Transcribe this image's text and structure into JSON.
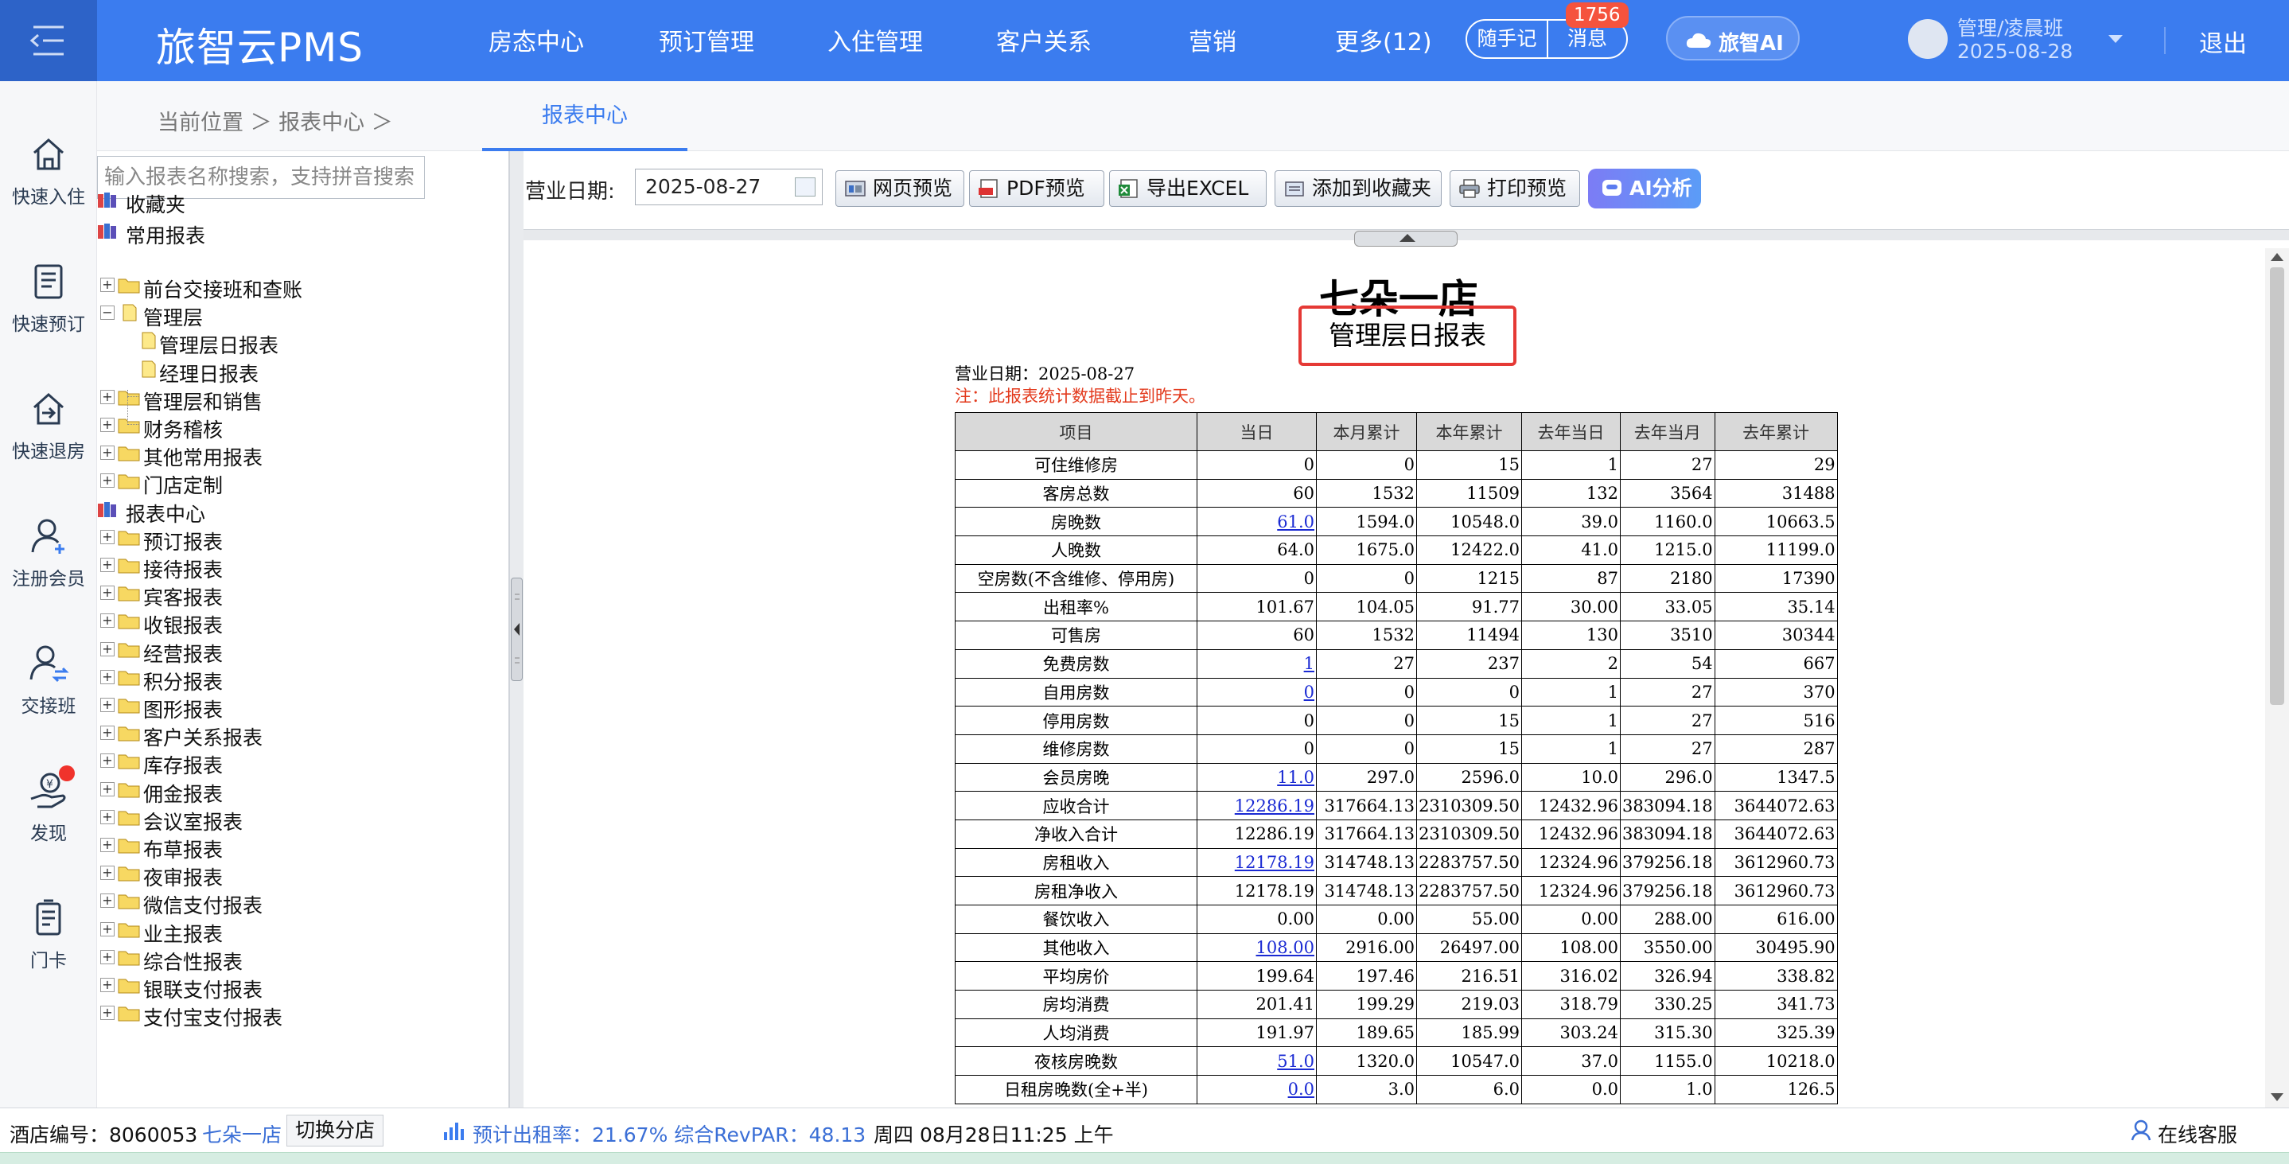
{
  "app": {
    "logo": "旅智云PMS",
    "nav": [
      "房态中心",
      "预订管理",
      "入住管理",
      "客户关系",
      "营销",
      "更多(12)"
    ],
    "memo_label": "随手记",
    "message_label": "消息",
    "message_badge": "1756",
    "ai_label": "旅智AI",
    "user_name": "管理/凌晨班",
    "user_date": "2025-08-28",
    "logout_label": "退出",
    "colors": {
      "primary": "#3b7cef",
      "highlight_border": "#e53935",
      "note": "#e33a1d",
      "link": "#1a2ad3"
    }
  },
  "sidebar": [
    {
      "label": "快速入住",
      "icon": "home-icon"
    },
    {
      "label": "快速预订",
      "icon": "booking-icon"
    },
    {
      "label": "快速退房",
      "icon": "checkout-icon"
    },
    {
      "label": "注册会员",
      "icon": "add-user-icon"
    },
    {
      "label": "交接班",
      "icon": "handover-icon"
    },
    {
      "label": "发现",
      "icon": "discover-icon"
    },
    {
      "label": "门卡",
      "icon": "card-icon"
    }
  ],
  "breadcrumb": "当前位置 ＞ 报表中心 ＞",
  "active_tab": "报表中心",
  "tree": {
    "search_placeholder": "输入报表名称搜索，支持拼音搜索",
    "favorites": "收藏夹",
    "common": "常用报表",
    "common_items": [
      "前台交接班和查账",
      "管理层",
      "管理层和销售",
      "财务稽核",
      "其他常用报表",
      "门店定制"
    ],
    "management_children": [
      "管理层日报表",
      "经理日报表"
    ],
    "center": "报表中心",
    "center_items": [
      "预订报表",
      "接待报表",
      "宾客报表",
      "收银报表",
      "经营报表",
      "积分报表",
      "图形报表",
      "客户关系报表",
      "库存报表",
      "佣金报表",
      "会议室报表",
      "布草报表",
      "夜审报表",
      "微信支付报表",
      "业主报表",
      "综合性报表",
      "银联支付报表",
      "支付宝支付报表"
    ]
  },
  "toolbar": {
    "date_label": "营业日期:",
    "date_value": "2025-08-27",
    "buttons": [
      "网页预览",
      "PDF预览",
      "导出EXCEL",
      "添加到收藏夹",
      "打印预览"
    ],
    "ai_analysis": "AI分析"
  },
  "report": {
    "hotel": "七朵一店",
    "title": "管理层日报表",
    "date_line": "营业日期：2025-08-27",
    "note": "注：此报表统计数据截止到昨天。",
    "columns": [
      "项目",
      "当日",
      "本月累计",
      "本年累计",
      "去年当日",
      "去年当月",
      "去年累计"
    ],
    "rows": [
      [
        "可住维修房",
        "0",
        "0",
        "15",
        "1",
        "27",
        "29"
      ],
      [
        "客房总数",
        "60",
        "1532",
        "11509",
        "132",
        "3564",
        "31488"
      ],
      [
        "房晚数",
        "61.0",
        "1594.0",
        "10548.0",
        "39.0",
        "1160.0",
        "10663.5"
      ],
      [
        "人晚数",
        "64.0",
        "1675.0",
        "12422.0",
        "41.0",
        "1215.0",
        "11199.0"
      ],
      [
        "空房数(不含维修、停用房)",
        "0",
        "0",
        "1215",
        "87",
        "2180",
        "17390"
      ],
      [
        "出租率%",
        "101.67",
        "104.05",
        "91.77",
        "30.00",
        "33.05",
        "35.14"
      ],
      [
        "可售房",
        "60",
        "1532",
        "11494",
        "130",
        "3510",
        "30344"
      ],
      [
        "免费房数",
        "1",
        "27",
        "237",
        "2",
        "54",
        "667"
      ],
      [
        "自用房数",
        "0",
        "0",
        "0",
        "1",
        "27",
        "370"
      ],
      [
        "停用房数",
        "0",
        "0",
        "15",
        "1",
        "27",
        "516"
      ],
      [
        "维修房数",
        "0",
        "0",
        "15",
        "1",
        "27",
        "287"
      ],
      [
        "会员房晚",
        "11.0",
        "297.0",
        "2596.0",
        "10.0",
        "296.0",
        "1347.5"
      ],
      [
        "应收合计",
        "12286.19",
        "317664.13",
        "2310309.50",
        "12432.96",
        "383094.18",
        "3644072.63"
      ],
      [
        "净收入合计",
        "12286.19",
        "317664.13",
        "2310309.50",
        "12432.96",
        "383094.18",
        "3644072.63"
      ],
      [
        "房租收入",
        "12178.19",
        "314748.13",
        "2283757.50",
        "12324.96",
        "379256.18",
        "3612960.73"
      ],
      [
        "房租净收入",
        "12178.19",
        "314748.13",
        "2283757.50",
        "12324.96",
        "379256.18",
        "3612960.73"
      ],
      [
        "餐饮收入",
        "0.00",
        "0.00",
        "55.00",
        "0.00",
        "288.00",
        "616.00"
      ],
      [
        "其他收入",
        "108.00",
        "2916.00",
        "26497.00",
        "108.00",
        "3550.00",
        "30495.90"
      ],
      [
        "平均房价",
        "199.64",
        "197.46",
        "216.51",
        "316.02",
        "326.94",
        "338.82"
      ],
      [
        "房均消费",
        "201.41",
        "199.29",
        "219.03",
        "318.79",
        "330.25",
        "341.73"
      ],
      [
        "人均消费",
        "191.97",
        "189.65",
        "185.99",
        "303.24",
        "315.30",
        "325.39"
      ],
      [
        "夜核房晚数",
        "51.0",
        "1320.0",
        "10547.0",
        "37.0",
        "1155.0",
        "10218.0"
      ],
      [
        "日租房晚数(全+半)",
        "0.0",
        "3.0",
        "6.0",
        "0.0",
        "1.0",
        "126.5"
      ]
    ],
    "linked_today_rows": [
      2,
      7,
      8,
      11,
      12,
      14,
      17,
      21,
      22
    ]
  },
  "status": {
    "hotel_no": "酒店编号：8060053",
    "hotel_name": "七朵一店",
    "switch_label": "切换分店",
    "forecast": "预计出租率：21.67% 综合RevPAR：48.13",
    "datetime": "周四 08月28日11:25 上午",
    "service": "在线客服"
  }
}
